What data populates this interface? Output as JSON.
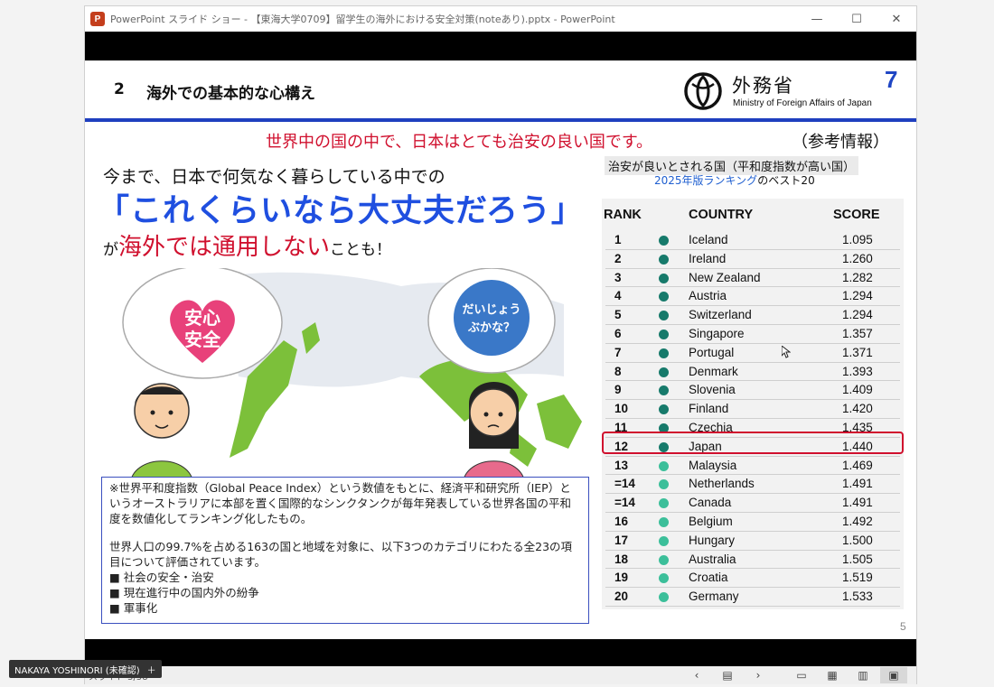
{
  "window": {
    "app_icon": "powerpoint-icon",
    "title": "PowerPoint スライド ショー - 【東海大学0709】留学生の海外における安全対策(noteあり).pptx - PowerPoint",
    "controls": [
      "minimize-icon",
      "maximize-icon",
      "close-icon"
    ]
  },
  "slide": {
    "number": "2",
    "title": "海外での基本的な心構え",
    "ministry_jp": "外務省",
    "ministry_en": "Ministry of Foreign Affairs of Japan",
    "page_number": "7",
    "headline": "世界中の国の中で、日本はとても治安の良い国です。",
    "reference": "（参考情報）",
    "ranking_caption_1": "治安が良いとされる国（平和度指数が高い国）",
    "ranking_caption_2_blue": "2025年版ランキング",
    "ranking_caption_2_rest": "のベスト20",
    "line1": "今まで、日本で何気なく暮らしている中での",
    "line2": "「これくらいなら大丈夫だろう」",
    "line3_prefix": "が",
    "line3_red": "海外では通用しない",
    "line3_suffix": "ことも！",
    "bubble_left": "安心安全",
    "bubble_right": "だいじょうぶかな？",
    "note": {
      "para1": "※世界平和度指数（Global Peace Index）という数値をもとに、経済平和研究所（IEP）というオーストラリアに本部を置く国際的なシンクタンクが毎年発表している世界各国の平和度を数値化してランキング化したもの。",
      "para2": "世界人口の99.7%を占める163の国と地域を対象に、以下3つのカテゴリにわたる全23の項目について評価されています。",
      "bullets": [
        "■ 社会の安全・治安",
        "■ 現在進行中の国内外の紛争",
        "■ 軍事化"
      ]
    },
    "small_page_number": "5",
    "table": {
      "headers": {
        "rank": "RANK",
        "country": "COUNTRY",
        "score": "SCORE"
      },
      "highlight_row": 11,
      "rows": [
        {
          "rank": "1",
          "country": "Iceland",
          "score": "1.095"
        },
        {
          "rank": "2",
          "country": "Ireland",
          "score": "1.260"
        },
        {
          "rank": "3",
          "country": "New Zealand",
          "score": "1.282"
        },
        {
          "rank": "4",
          "country": "Austria",
          "score": "1.294"
        },
        {
          "rank": "5",
          "country": "Switzerland",
          "score": "1.294"
        },
        {
          "rank": "6",
          "country": "Singapore",
          "score": "1.357"
        },
        {
          "rank": "7",
          "country": "Portugal",
          "score": "1.371"
        },
        {
          "rank": "8",
          "country": "Denmark",
          "score": "1.393"
        },
        {
          "rank": "9",
          "country": "Slovenia",
          "score": "1.409"
        },
        {
          "rank": "10",
          "country": "Finland",
          "score": "1.420"
        },
        {
          "rank": "11",
          "country": "Czechia",
          "score": "1.435"
        },
        {
          "rank": "12",
          "country": "Japan",
          "score": "1.440"
        },
        {
          "rank": "13",
          "country": "Malaysia",
          "score": "1.469"
        },
        {
          "rank": "=14",
          "country": "Netherlands",
          "score": "1.491"
        },
        {
          "rank": "=14",
          "country": "Canada",
          "score": "1.491"
        },
        {
          "rank": "16",
          "country": "Belgium",
          "score": "1.492"
        },
        {
          "rank": "17",
          "country": "Hungary",
          "score": "1.500"
        },
        {
          "rank": "18",
          "country": "Australia",
          "score": "1.505"
        },
        {
          "rank": "19",
          "country": "Croatia",
          "score": "1.519"
        },
        {
          "rank": "20",
          "country": "Germany",
          "score": "1.533"
        }
      ],
      "dot_dark": "#177a6b",
      "dot_light": "#3cbf9a"
    }
  },
  "status": {
    "slide_counter": "スライド 5/58",
    "icons": [
      "prev-icon",
      "notes-icon",
      "next-icon",
      "normal-view-icon",
      "slide-sorter-icon",
      "reading-view-icon",
      "slideshow-icon"
    ]
  },
  "participant_label": "NAKAYA YOSHINORI (未確認)",
  "colors": {
    "accent_blue": "#1f3fbf",
    "accent_red": "#d0102e",
    "highlight_blue": "#1f4fe0"
  }
}
